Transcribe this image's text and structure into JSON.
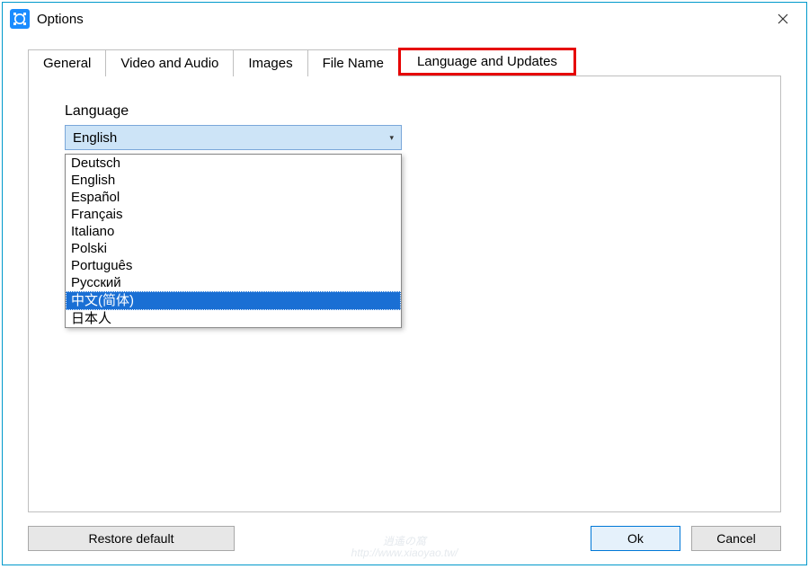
{
  "window": {
    "title": "Options"
  },
  "tabs": [
    {
      "label": "General"
    },
    {
      "label": "Video and Audio"
    },
    {
      "label": "Images"
    },
    {
      "label": "File Name"
    },
    {
      "label": "Language and Updates"
    }
  ],
  "panel": {
    "language_label": "Language",
    "language_selected": "English",
    "language_options": [
      "Deutsch",
      "English",
      "Español",
      "Français",
      "Italiano",
      "Polski",
      "Português",
      "Русский",
      "中文(简体)",
      "日本人"
    ],
    "language_highlighted_index": 8
  },
  "buttons": {
    "restore": "Restore default",
    "ok": "Ok",
    "cancel": "Cancel"
  },
  "watermark": {
    "line1": "逍遙の窩",
    "line2": "http://www.xiaoyao.tw/"
  }
}
